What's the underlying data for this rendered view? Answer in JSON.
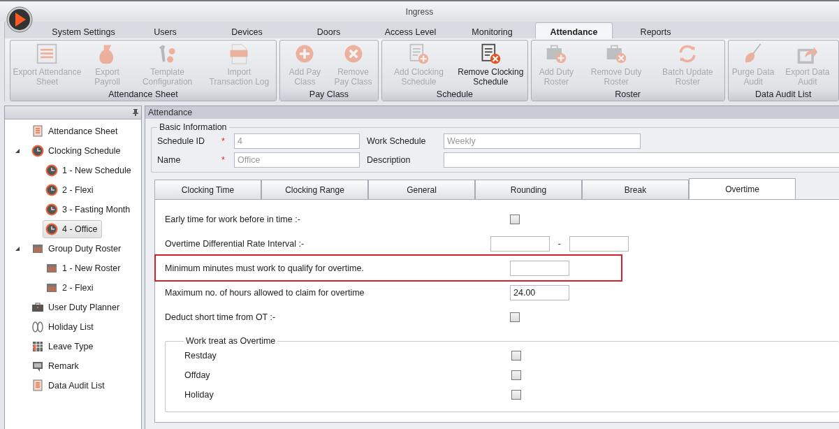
{
  "window": {
    "title": "Ingress"
  },
  "menu_tabs": [
    {
      "label": "System Settings",
      "selected": false
    },
    {
      "label": "Users",
      "selected": false
    },
    {
      "label": "Devices",
      "selected": false
    },
    {
      "label": "Doors",
      "selected": false
    },
    {
      "label": "Access Level",
      "selected": false
    },
    {
      "label": "Monitoring",
      "selected": false
    },
    {
      "label": "Attendance",
      "selected": true
    },
    {
      "label": "Reports",
      "selected": false
    }
  ],
  "ribbon": [
    {
      "label": "Attendance Sheet",
      "buttons": [
        {
          "label": "Export Attendance Sheet",
          "disabled": true
        },
        {
          "label": "Export Payroll",
          "disabled": true
        },
        {
          "label": "Template Configuration",
          "disabled": true
        },
        {
          "label": "Import Transaction Log",
          "disabled": true
        }
      ]
    },
    {
      "label": "Pay Class",
      "buttons": [
        {
          "label": "Add Pay Class",
          "disabled": true
        },
        {
          "label": "Remove Pay Class",
          "disabled": true
        }
      ]
    },
    {
      "label": "Schedule",
      "buttons": [
        {
          "label": "Add Clocking Schedule",
          "disabled": true
        },
        {
          "label": "Remove Clocking Schedule",
          "disabled": false
        }
      ]
    },
    {
      "label": "Roster",
      "buttons": [
        {
          "label": "Add Duty Roster",
          "disabled": true
        },
        {
          "label": "Remove Duty Roster",
          "disabled": true
        },
        {
          "label": "Batch Update Roster",
          "disabled": true
        }
      ]
    },
    {
      "label": "Data Audit List",
      "buttons": [
        {
          "label": "Purge Data Audit",
          "disabled": true
        },
        {
          "label": "Export Data Audit",
          "disabled": true
        }
      ]
    }
  ],
  "sidebar": {
    "items": [
      {
        "label": "Attendance Sheet",
        "selected": false
      },
      {
        "label": "Clocking Schedule",
        "selected": false,
        "expanded": true,
        "children": [
          {
            "label": "1 - New Schedule",
            "selected": false
          },
          {
            "label": "2 - Flexi",
            "selected": false
          },
          {
            "label": "3 - Fasting Month",
            "selected": false
          },
          {
            "label": "4 - Office",
            "selected": true
          }
        ]
      },
      {
        "label": "Group Duty Roster",
        "selected": false,
        "expanded": true,
        "children": [
          {
            "label": "1 - New Roster",
            "selected": false
          },
          {
            "label": "2 - Flexi",
            "selected": false
          }
        ]
      },
      {
        "label": "User Duty Planner",
        "selected": false
      },
      {
        "label": "Holiday List",
        "selected": false
      },
      {
        "label": "Leave Type",
        "selected": false
      },
      {
        "label": "Remark",
        "selected": false
      },
      {
        "label": "Data Audit List",
        "selected": false
      }
    ]
  },
  "panel": {
    "title": "Attendance",
    "basic_information": {
      "title": "Basic Information",
      "fields": [
        {
          "label": "Schedule ID",
          "required_mark": "*",
          "value": "4",
          "disabled": true
        },
        {
          "label": "Work Schedule",
          "value": "Weekly",
          "disabled": true
        },
        {
          "label": "Name",
          "required_mark": "*",
          "value": "Office",
          "disabled": true
        },
        {
          "label": "Description"
        }
      ]
    },
    "tabs": [
      {
        "label": "Clocking Time",
        "selected": false
      },
      {
        "label": "Clocking Range",
        "selected": false
      },
      {
        "label": "General",
        "selected": false
      },
      {
        "label": "Rounding",
        "selected": false
      },
      {
        "label": "Break",
        "selected": false
      },
      {
        "label": "Overtime",
        "selected": true
      }
    ],
    "overtime": {
      "rows": [
        {
          "kind": "checkbox",
          "label": "Early time for work before in time :-",
          "checked": false
        },
        {
          "kind": "range",
          "label": "Overtime Differential Rate Interval :-",
          "separator": "-"
        },
        {
          "kind": "text",
          "label": "Minimum minutes must work to qualify for overtime.",
          "highlighted": true
        },
        {
          "kind": "text",
          "label": "Maximum no. of hours allowed to claim for overtime",
          "value": "24.00"
        },
        {
          "kind": "checkbox",
          "label": "Deduct short time from OT :-",
          "checked": false
        }
      ],
      "work_treat_as_overtime": {
        "title": "Work treat as Overtime",
        "rows": [
          {
            "label": "Restday",
            "checked": false
          },
          {
            "label": "Offday",
            "checked": false
          },
          {
            "label": "Holiday",
            "checked": false
          }
        ]
      }
    }
  }
}
